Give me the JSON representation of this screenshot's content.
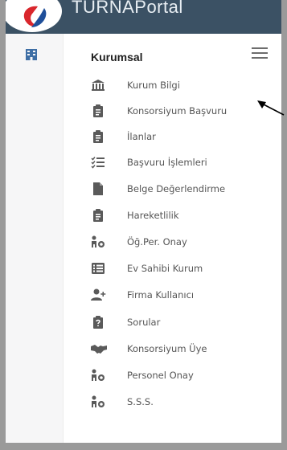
{
  "header": {
    "app_title": "TURNAPortal",
    "logo_icon": "turna-logo-icon"
  },
  "rail": {
    "icon": "building-icon"
  },
  "section": {
    "title": "Kurumsal",
    "menu_icon": "hamburger-icon"
  },
  "menu": {
    "items": [
      {
        "label": "Kurum Bilgi",
        "icon": "institution-icon"
      },
      {
        "label": "Konsorsiyum Başvuru",
        "icon": "clipboard-icon"
      },
      {
        "label": "İlanlar",
        "icon": "clipboard-icon"
      },
      {
        "label": "Başvuru İşlemleri",
        "icon": "checklist-icon"
      },
      {
        "label": "Belge Değerlendirme",
        "icon": "file-icon"
      },
      {
        "label": "Hareketlilik",
        "icon": "clipboard-icon"
      },
      {
        "label": "Öğ.Per. Onay",
        "icon": "user-approve-icon"
      },
      {
        "label": "Ev Sahibi Kurum",
        "icon": "list-icon"
      },
      {
        "label": "Firma Kullanıcı",
        "icon": "user-plus-icon"
      },
      {
        "label": "Sorular",
        "icon": "question-clipboard-icon"
      },
      {
        "label": "Konsorsiyum Üye",
        "icon": "handshake-icon"
      },
      {
        "label": "Personel Onay",
        "icon": "user-approve-icon"
      },
      {
        "label": "S.S.S.",
        "icon": "user-approve-icon"
      }
    ]
  },
  "annotation": {
    "icon": "pointer-arrow-icon"
  },
  "colors": {
    "header_bg": "#3b5164",
    "icon": "#5a5a5a",
    "logo_red": "#d9262c",
    "logo_blue": "#1f4f9a"
  }
}
